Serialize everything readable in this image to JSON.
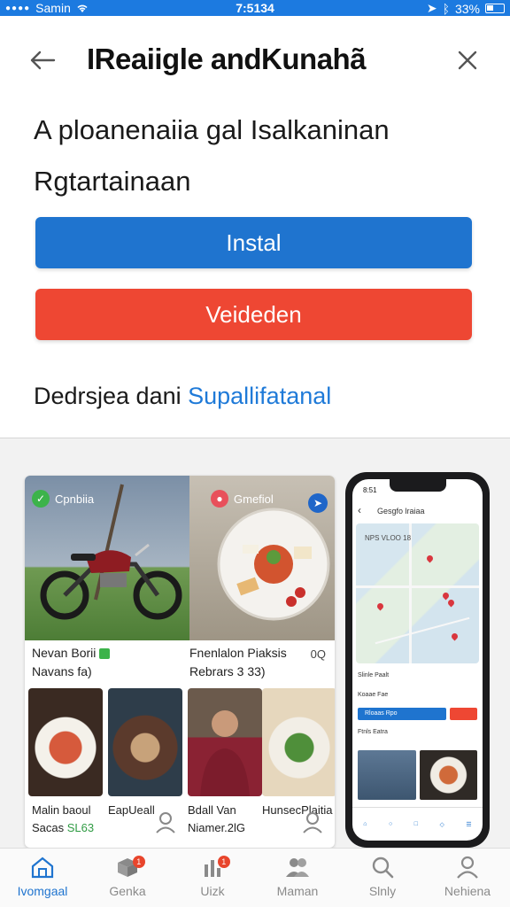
{
  "status_bar": {
    "carrier": "Samin",
    "time": "7:5134",
    "battery": "33%"
  },
  "header": {
    "title": "IReaiigle andKunahã"
  },
  "subtitle": "A ploanenaiia gal Isalkaninan Rgtartainaan",
  "buttons": {
    "install": "Instal",
    "video": "Veideden"
  },
  "developer": {
    "prefix": "Dedrsjea dani",
    "link": "Supallifatanal"
  },
  "colors": {
    "accent": "#1f74cf",
    "danger": "#ee4733",
    "status_bar": "#1c7ae0",
    "success": "#3cb34a"
  },
  "gallery": {
    "tag_left": "Cpnbiia",
    "tag_right": "Gmefiol",
    "info_left": {
      "line1": "Nevan Borii",
      "line2": "Navans fa)"
    },
    "info_right": {
      "line1": "Fnenlalon Piaksis",
      "line2": "Rebrars 3 33)",
      "icon": "0Q"
    },
    "captions": [
      {
        "line1": "Malin baoul",
        "line2": "Sacas",
        "green": "SL63"
      },
      {
        "line1": "EapUeall",
        "line2": ""
      },
      {
        "line1": "Bdall Van",
        "line2": "Niamer.2lG"
      },
      {
        "line1": "HunsecPlaitia",
        "line2": ""
      }
    ]
  },
  "phone": {
    "time": "8:51",
    "title": "Gesgfo lraiaa",
    "map_label": "NPS VLOO 18",
    "row1": "Slinle Paalt",
    "row2": "Koaae Fae",
    "btn": "Rloaas Rpo",
    "row3": "Ftnls Eatra"
  },
  "tabs": [
    {
      "label": "Ivomgaal",
      "icon": "home-icon",
      "active": true,
      "badge": ""
    },
    {
      "label": "Genka",
      "icon": "box-icon",
      "active": false,
      "badge": "1"
    },
    {
      "label": "Uizk",
      "icon": "chart-icon",
      "active": false,
      "badge": "1"
    },
    {
      "label": "Maman",
      "icon": "people-icon",
      "active": false,
      "badge": ""
    },
    {
      "label": "Slnly",
      "icon": "search-icon",
      "active": false,
      "badge": ""
    },
    {
      "label": "Nehiena",
      "icon": "person-icon",
      "active": false,
      "badge": ""
    }
  ]
}
